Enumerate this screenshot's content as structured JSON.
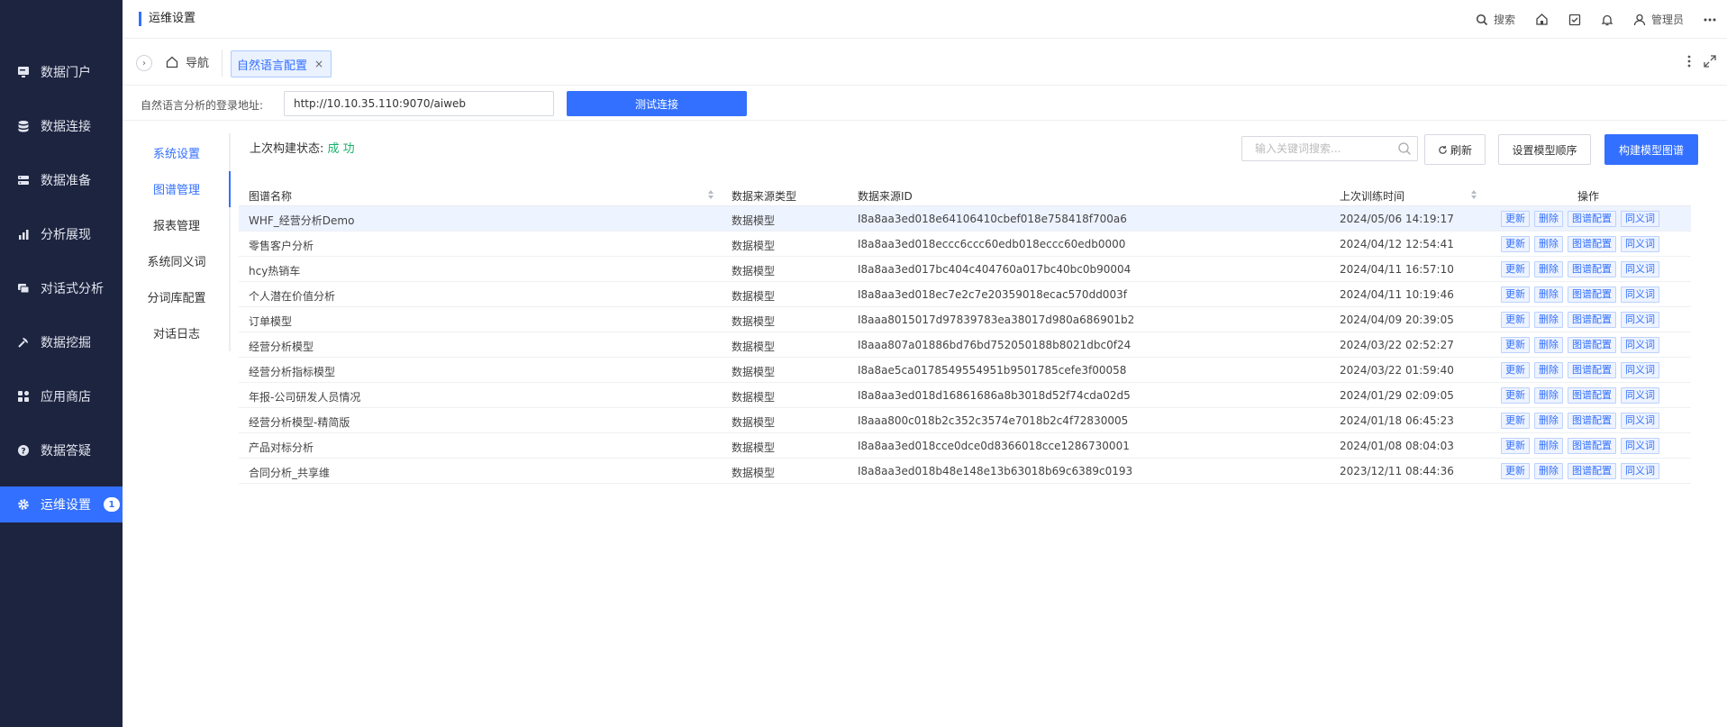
{
  "sidebar": {
    "items": [
      {
        "label": "数据门户",
        "icon": "portal-icon"
      },
      {
        "label": "数据连接",
        "icon": "database-icon"
      },
      {
        "label": "数据准备",
        "icon": "server-icon"
      },
      {
        "label": "分析展现",
        "icon": "bar-chart-icon"
      },
      {
        "label": "对话式分析",
        "icon": "chat-icon"
      },
      {
        "label": "数据挖掘",
        "icon": "pickaxe-icon"
      },
      {
        "label": "应用商店",
        "icon": "apps-icon"
      },
      {
        "label": "数据答疑",
        "icon": "question-icon"
      },
      {
        "label": "运维设置",
        "icon": "gear-icon",
        "badge": "1"
      }
    ],
    "active_index": 8
  },
  "header": {
    "title": "运维设置",
    "search": "搜索",
    "user": "管理员"
  },
  "tabs": {
    "nav_label": "导航",
    "active_label": "自然语言配置",
    "close_symbol": "×"
  },
  "url_row": {
    "label": "自然语言分析的登录地址:",
    "value": "http://10.10.35.110:9070/aiweb",
    "test_button": "测试连接"
  },
  "submenu": {
    "items": [
      "系统设置",
      "图谱管理",
      "报表管理",
      "系统同义词",
      "分词库配置",
      "对话日志"
    ],
    "active_index": 1
  },
  "toolbar": {
    "status_label": "上次构建状态:",
    "status_value": "成 功",
    "search_placeholder": "输入关键词搜索...",
    "refresh": "刷新",
    "set_order": "设置模型顺序",
    "build": "构建模型图谱"
  },
  "table": {
    "headers": [
      "图谱名称",
      "数据来源类型",
      "数据来源ID",
      "上次训练时间",
      "操作"
    ],
    "op_labels": [
      "更新",
      "删除",
      "图谱配置",
      "同义词"
    ],
    "rows": [
      {
        "name": "WHF_经营分析Demo",
        "type": "数据模型",
        "id": "I8a8aa3ed018e64106410cbef018e758418f700a6",
        "time": "2024/05/06 14:19:17"
      },
      {
        "name": "零售客户分析",
        "type": "数据模型",
        "id": "I8a8aa3ed018eccc6ccc60edb018eccc60edb0000",
        "time": "2024/04/12 12:54:41"
      },
      {
        "name": "hcy热销车",
        "type": "数据模型",
        "id": "I8a8aa3ed017bc404c404760a017bc40bc0b90004",
        "time": "2024/04/11 16:57:10"
      },
      {
        "name": "个人潜在价值分析",
        "type": "数据模型",
        "id": "I8a8aa3ed018ec7e2c7e20359018ecac570dd003f",
        "time": "2024/04/11 10:19:46"
      },
      {
        "name": "订单模型",
        "type": "数据模型",
        "id": "I8aaa8015017d97839783ea38017d980a686901b2",
        "time": "2024/04/09 20:39:05"
      },
      {
        "name": "经营分析模型",
        "type": "数据模型",
        "id": "I8aaa807a01886bd76bd752050188b8021dbc0f24",
        "time": "2024/03/22 02:52:27"
      },
      {
        "name": "经营分析指标模型",
        "type": "数据模型",
        "id": "I8a8ae5ca0178549554951b9501785cefe3f00058",
        "time": "2024/03/22 01:59:40"
      },
      {
        "name": "年报-公司研发人员情况",
        "type": "数据模型",
        "id": "I8a8aa3ed018d16861686a8b3018d52f74cda02d5",
        "time": "2024/01/29 02:09:05"
      },
      {
        "name": "经营分析模型-精简版",
        "type": "数据模型",
        "id": "I8aaa800c018b2c352c3574e7018b2c4f72830005",
        "time": "2024/01/18 06:45:23"
      },
      {
        "name": "产品对标分析",
        "type": "数据模型",
        "id": "I8a8aa3ed018cce0dce0d8366018cce1286730001",
        "time": "2024/01/08 08:04:03"
      },
      {
        "name": "合同分析_共享维",
        "type": "数据模型",
        "id": "I8a8aa3ed018b48e148e13b63018b69c6389c0193",
        "time": "2023/12/11 08:44:36"
      }
    ]
  }
}
